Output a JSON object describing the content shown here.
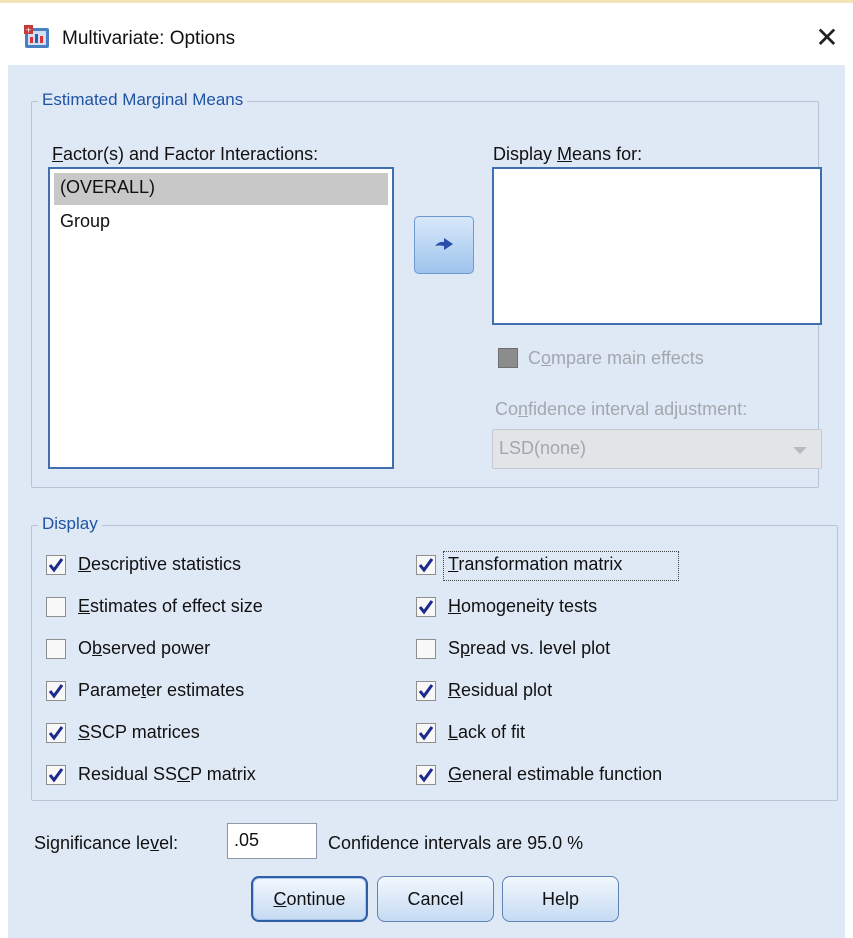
{
  "window": {
    "title": "Multivariate: Options",
    "close_glyph": "✕"
  },
  "emm": {
    "group_title": "Estimated Marginal Means",
    "factors_label": {
      "pre": "",
      "u": "F",
      "post": "actor(s) and Factor Interactions:"
    },
    "factors": [
      "(OVERALL)",
      "Group"
    ],
    "selected_index": 0,
    "display_means_label": {
      "pre": "Display ",
      "u": "M",
      "post": "eans for:"
    },
    "compare_main_effects": {
      "pre": "C",
      "u": "o",
      "post": "mpare main effects",
      "checked": false,
      "enabled": false
    },
    "ci_adjust_label": {
      "pre": "Co",
      "u": "n",
      "post": "fidence interval adjustment:"
    },
    "ci_adjust_value": "LSD(none)"
  },
  "display": {
    "group_title": "Display",
    "left": [
      {
        "pre": "",
        "u": "D",
        "post": "escriptive statistics",
        "checked": true
      },
      {
        "pre": "",
        "u": "E",
        "post": "stimates of effect size",
        "checked": false
      },
      {
        "pre": "O",
        "u": "b",
        "post": "served power",
        "checked": false
      },
      {
        "pre": "Parame",
        "u": "t",
        "post": "er estimates",
        "checked": true
      },
      {
        "pre": "",
        "u": "S",
        "post": "SCP matrices",
        "checked": true
      },
      {
        "pre": "Residual SS",
        "u": "C",
        "post": "P matrix",
        "checked": true
      }
    ],
    "right": [
      {
        "pre": "",
        "u": "T",
        "post": "ransformation matrix",
        "checked": true
      },
      {
        "pre": "",
        "u": "H",
        "post": "omogeneity tests",
        "checked": true
      },
      {
        "pre": "S",
        "u": "p",
        "post": "read vs. level plot",
        "checked": false
      },
      {
        "pre": "",
        "u": "R",
        "post": "esidual plot",
        "checked": true
      },
      {
        "pre": "",
        "u": "L",
        "post": "ack of fit",
        "checked": true
      },
      {
        "pre": "",
        "u": "G",
        "post": "eneral estimable function",
        "checked": true
      }
    ]
  },
  "significance": {
    "label": {
      "pre": "Significance le",
      "u": "v",
      "post": "el:"
    },
    "value": ".05",
    "ci_text": "Confidence intervals are 95.0 %"
  },
  "buttons": {
    "continue": {
      "pre": "",
      "u": "C",
      "post": "ontinue"
    },
    "cancel": "Cancel",
    "help": "Help"
  },
  "colors": {
    "accent": "#1f53a3",
    "client_bg": "#dfe9f6",
    "check": "#1b2a8c"
  }
}
